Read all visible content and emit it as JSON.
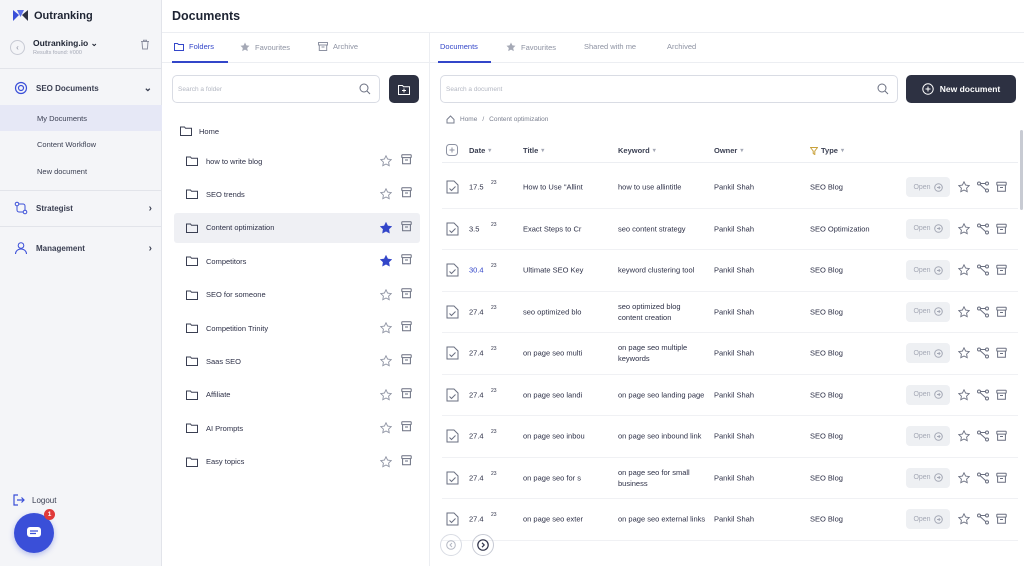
{
  "app": {
    "name": "Outranking"
  },
  "workspace": {
    "name": "Outranking.io",
    "sub": "Results found: #000"
  },
  "sidebar": {
    "groups": [
      {
        "label": "SEO Documents",
        "icon": "seo-documents-icon"
      },
      {
        "label": "Strategist",
        "icon": "strategist-icon"
      },
      {
        "label": "Management",
        "icon": "management-icon"
      }
    ],
    "sub_items": [
      "My Documents",
      "Content Workflow",
      "New document"
    ],
    "logout_label": "Logout",
    "chat_badge": "1"
  },
  "header": {
    "title": "Documents"
  },
  "folder_panel": {
    "tabs": [
      "Folders",
      "Favourites",
      "Archive"
    ],
    "search_placeholder": "Search a folder",
    "home_label": "Home",
    "folders": [
      {
        "name": "how to write blog",
        "starred": false
      },
      {
        "name": "SEO trends",
        "starred": false
      },
      {
        "name": "Content optimization",
        "starred": true
      },
      {
        "name": "Competitors",
        "starred": true
      },
      {
        "name": "SEO for someone",
        "starred": false
      },
      {
        "name": "Competition Trinity",
        "starred": false
      },
      {
        "name": "Saas SEO",
        "starred": false
      },
      {
        "name": "Affiliate",
        "starred": false
      },
      {
        "name": "AI Prompts",
        "starred": false
      },
      {
        "name": "Easy topics",
        "starred": false
      }
    ]
  },
  "doc_panel": {
    "tabs": [
      "Documents",
      "Favourites",
      "Shared with me",
      "Archived"
    ],
    "search_placeholder": "Search a document",
    "new_document_label": "New document",
    "breadcrumb": [
      "Home",
      "Content optimization"
    ],
    "columns": [
      "Date",
      "Title",
      "Keyword",
      "Owner",
      "Type"
    ],
    "open_label": "Open",
    "rows": [
      {
        "date": "17.5",
        "year": "23",
        "title": "How to Use \"Allint",
        "keyword": "how to use allintitle",
        "owner": "Pankil Shah",
        "type": "SEO Blog"
      },
      {
        "date": "3.5",
        "year": "23",
        "title": "Exact Steps to Cr",
        "keyword": "seo content strategy",
        "owner": "Pankil Shah",
        "type": "SEO Optimization"
      },
      {
        "date": "30.4",
        "year": "23",
        "title": "Ultimate SEO Key",
        "keyword": "keyword clustering tool",
        "owner": "Pankil Shah",
        "type": "SEO Blog"
      },
      {
        "date": "27.4",
        "year": "23",
        "title": "seo optimized blo",
        "keyword": "seo optimized blog content creation",
        "owner": "Pankil Shah",
        "type": "SEO Blog"
      },
      {
        "date": "27.4",
        "year": "23",
        "title": "on page seo multi",
        "keyword": "on page seo multiple keywords",
        "owner": "Pankil Shah",
        "type": "SEO Blog"
      },
      {
        "date": "27.4",
        "year": "23",
        "title": "on page seo landi",
        "keyword": "on page seo landing page",
        "owner": "Pankil Shah",
        "type": "SEO Blog"
      },
      {
        "date": "27.4",
        "year": "23",
        "title": "on page seo inbou",
        "keyword": "on page seo inbound link",
        "owner": "Pankil Shah",
        "type": "SEO Blog"
      },
      {
        "date": "27.4",
        "year": "23",
        "title": "on page seo for s",
        "keyword": "on page seo for small business",
        "owner": "Pankil Shah",
        "type": "SEO Blog"
      },
      {
        "date": "27.4",
        "year": "23",
        "title": "on page seo exter",
        "keyword": "on page seo external links",
        "owner": "Pankil Shah",
        "type": "SEO Blog"
      }
    ]
  },
  "colors": {
    "accent": "#3346c9",
    "dark_button": "#2d3142",
    "chat": "#3a4fd8",
    "star_filled": "#3346c9"
  }
}
